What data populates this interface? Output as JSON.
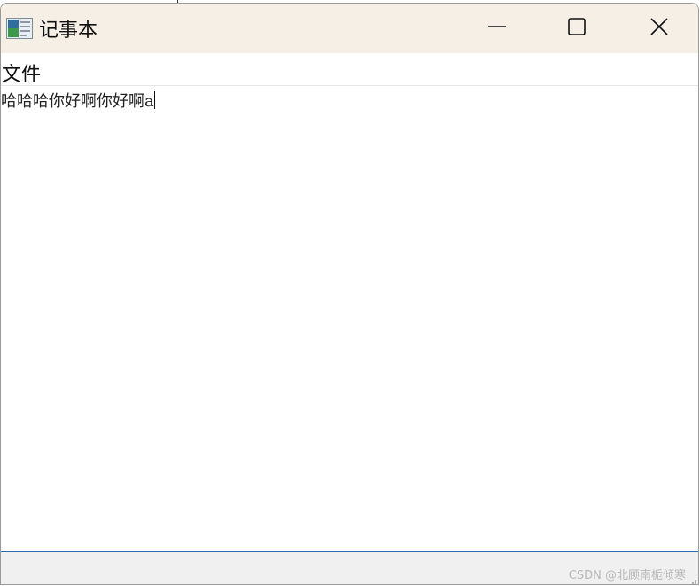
{
  "window": {
    "title": "记事本",
    "app_icon": "notepad-app-icon",
    "controls": {
      "minimize_icon": "minimize-icon",
      "maximize_icon": "maximize-icon",
      "close_icon": "close-icon"
    }
  },
  "menubar": {
    "items": [
      {
        "label": "文件"
      }
    ]
  },
  "editor": {
    "content": "哈哈哈你好啊你好啊a"
  },
  "statusbar": {
    "text": ""
  },
  "watermark": {
    "text": "CSDN @北顾南栀倾寒"
  },
  "colors": {
    "titlebar_bg": "#f6efe6",
    "statusbar_bg": "#f0f0f0",
    "statusbar_border": "#2b6cb0"
  }
}
